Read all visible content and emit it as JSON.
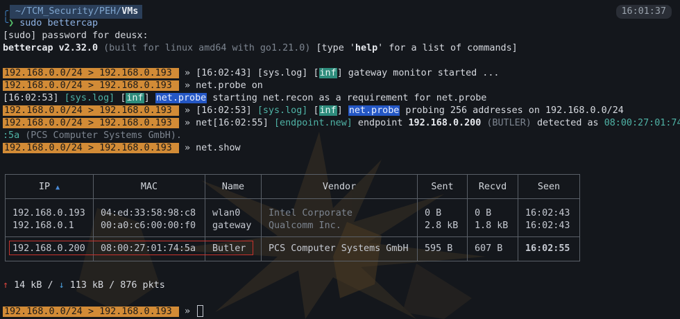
{
  "prompt": {
    "path_prefix": "~/TCM_Security/PEH/",
    "path_current": "VMs",
    "clock": "16:01:37",
    "chevron": "❯",
    "command": "sudo bettercap"
  },
  "output": {
    "sudo_prompt": "[sudo] password for deusx:",
    "banner_name": "bettercap v2.32.0",
    "banner_build": " (built for linux amd64 with go1.21.0) ",
    "banner_help_pre": "[type '",
    "banner_help_word": "help",
    "banner_help_post": "' for a list of commands]"
  },
  "session_prompt": {
    "subnet": "192.168.0.0/24",
    "sep": ">",
    "host": "192.168.0.193",
    "arrow": "»"
  },
  "log": {
    "l1_time": "[16:02:43] ",
    "l1_syslog": "[sys.log]",
    "l1_inf": "inf",
    "l1_msg": " gateway monitor started ...",
    "l2_cmd": " net.probe on",
    "l3_time": "[16:02:53] ",
    "l3_syslog": "[sys.log]",
    "l3_inf": "inf",
    "l3_np": "net.probe",
    "l3_msg": " starting net.recon as a requirement for net.probe",
    "l4_time": "[16:02:53] ",
    "l4_syslog": "[sys.log]",
    "l4_inf": "inf",
    "l4_np": "net.probe",
    "l4_msg": " probing 256 addresses on 192.168.0.0/24",
    "l5_pre": " net[16:02:55] ",
    "l5_tag": "[endpoint.new]",
    "l5_mid": " endpoint ",
    "l5_ip": "192.168.0.200",
    "l5_host": " (BUTLER) ",
    "l5_det": "detected as ",
    "l5_mac": "08:00:27:01:74",
    "l6_mac": ":5a",
    "l6_vendor": " (PCS Computer Systems GmbH).",
    "l7_cmd": " net.show"
  },
  "table": {
    "headers": {
      "ip": "IP",
      "sort_arrow": "▲",
      "mac": "MAC",
      "name": "Name",
      "vendor": "Vendor",
      "sent": "Sent",
      "recvd": "Recvd",
      "seen": "Seen"
    },
    "rows": [
      {
        "ip": "192.168.0.193",
        "mac": "04:ed:33:58:98:c8",
        "name": "wlan0",
        "vendor": "Intel Corporate",
        "sent": "0 B",
        "recvd": "0 B",
        "seen": "16:02:43"
      },
      {
        "ip": "192.168.0.1",
        "mac": "00:a0:c6:00:00:f0",
        "name": "gateway",
        "vendor": "Qualcomm Inc.",
        "sent": "2.8 kB",
        "recvd": "1.8 kB",
        "seen": "16:02:43"
      },
      {
        "ip": "192.168.0.200",
        "mac": "08:00:27:01:74:5a",
        "name": "Butler",
        "vendor": "PCS Computer Systems GmbH",
        "sent": "595 B",
        "recvd": "607 B",
        "seen": "16:02:55"
      }
    ]
  },
  "stats": {
    "up_icon": "↑",
    "sent": " 14 kB / ",
    "down_icon": "↓",
    "recvd": " 113 kB / 876 pkts"
  },
  "colors": {
    "background": "#14171c",
    "prompt_bg": "#d28b36",
    "inf_bg": "#2e8c7c",
    "netprobe_bg": "#2457c5",
    "highlight_box": "#c8322c"
  }
}
